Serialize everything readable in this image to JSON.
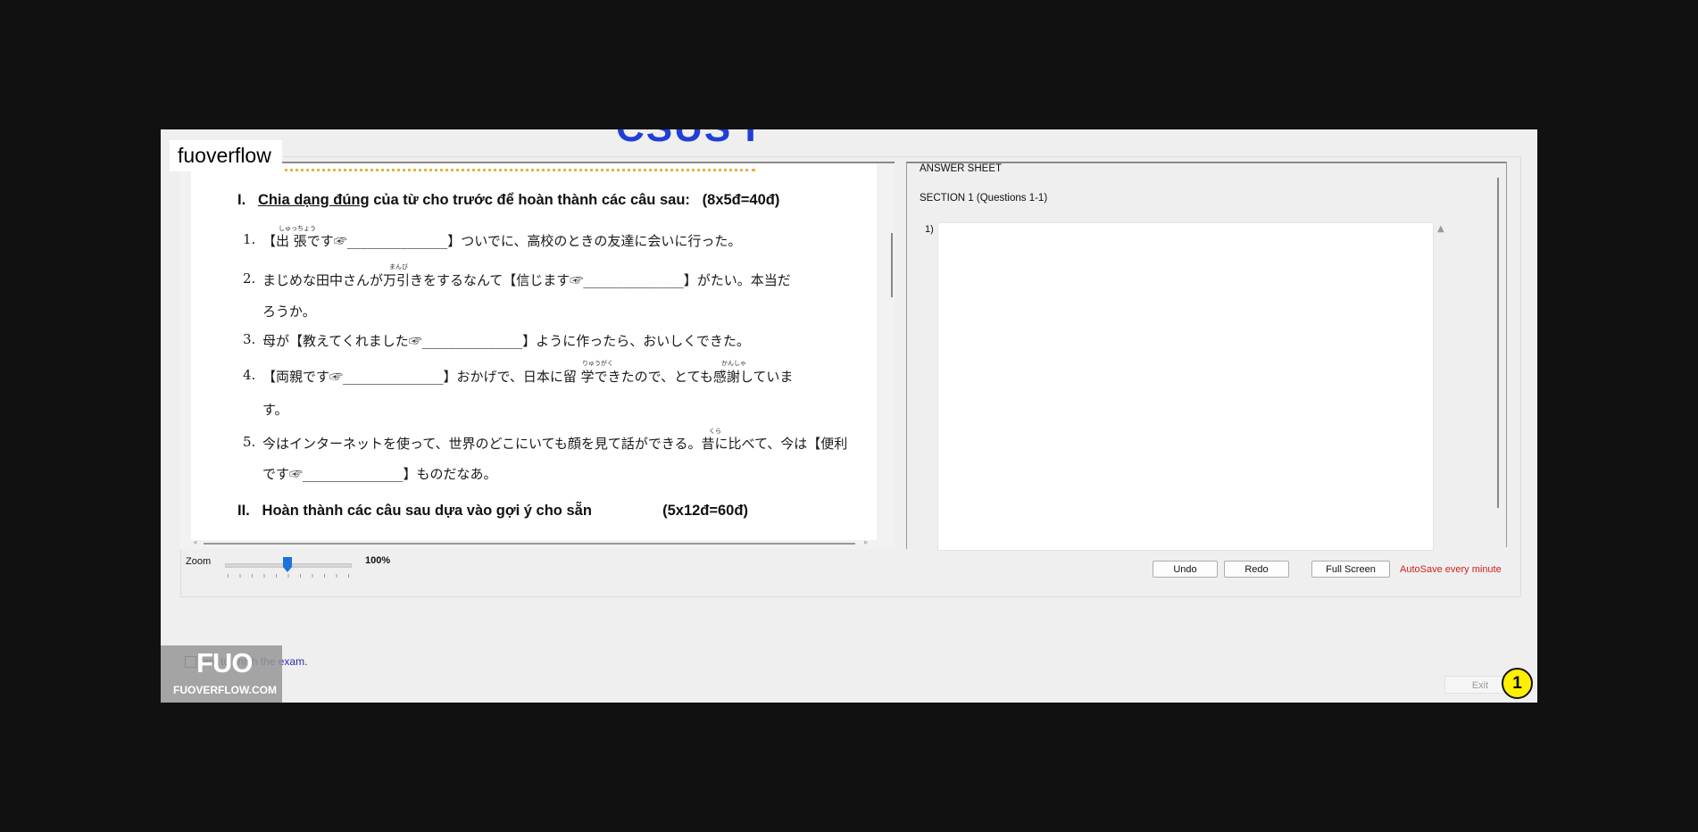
{
  "watermark": {
    "top_text": "fuoverflow",
    "logo_big": "FUO",
    "logo_small": "FUOVERFLOW.COM"
  },
  "header": {
    "cut_title": "CSUS I"
  },
  "question": {
    "section1": {
      "roman": "I.",
      "underlined": "Chia dạng đúng",
      "rest": "của từ cho trước để hoàn thành các câu sau:",
      "score": "(8x5đ=40đ)"
    },
    "items": [
      {
        "num": "1.",
        "line1": "【出 張です☞_______________】ついでに、高校のときの友達に会いに行った。",
        "line2": "",
        "furigana": "しゅっちょう"
      },
      {
        "num": "2.",
        "line1": "まじめな田中さんが万引きをするなんて【信じます☞_______________】がたい。本当だ",
        "line2": "ろうか。",
        "furigana": "まんび"
      },
      {
        "num": "3.",
        "line1": "母が【教えてくれました☞_______________】ように作ったら、おいしくできた。",
        "line2": "",
        "furigana": ""
      },
      {
        "num": "4.",
        "line1": "【両親です☞_______________】おかげで、日本に留 学できたので、とても感謝していま",
        "line2": "す。",
        "furigana": "りゅうがく",
        "furigana2": "かんしゃ"
      },
      {
        "num": "5.",
        "line1": "今はインターネットを使って、世界のどこにいても顔を見て話ができる。昔に比べて、今は【便利",
        "line2": "です☞_______________】ものだなあ。",
        "furigana": "くら"
      }
    ],
    "section2": {
      "roman": "II.",
      "text": "Hoàn thành các câu sau dựa vào gợi ý cho sẵn",
      "score": "(5x12đ=60đ)"
    }
  },
  "answer_sheet": {
    "title": "ANSWER SHEET",
    "section": "SECTION 1 (Questions 1-1)",
    "question_no": "1)",
    "answer_value": ""
  },
  "zoom": {
    "label": "Zoom",
    "value": "100%",
    "level_percent": 50
  },
  "buttons": {
    "undo": "Undo",
    "redo": "Redo",
    "fullscreen": "Full Screen",
    "exit": "Exit"
  },
  "autosave": "AutoSave every minute",
  "finish": {
    "label": "ant to finish the exam."
  },
  "marker": "1",
  "colors": {
    "autosave": "#d22020",
    "finish_text": "#2b2bb0",
    "zoom_thumb": "#1a73d6",
    "marker": "#ffef00"
  }
}
